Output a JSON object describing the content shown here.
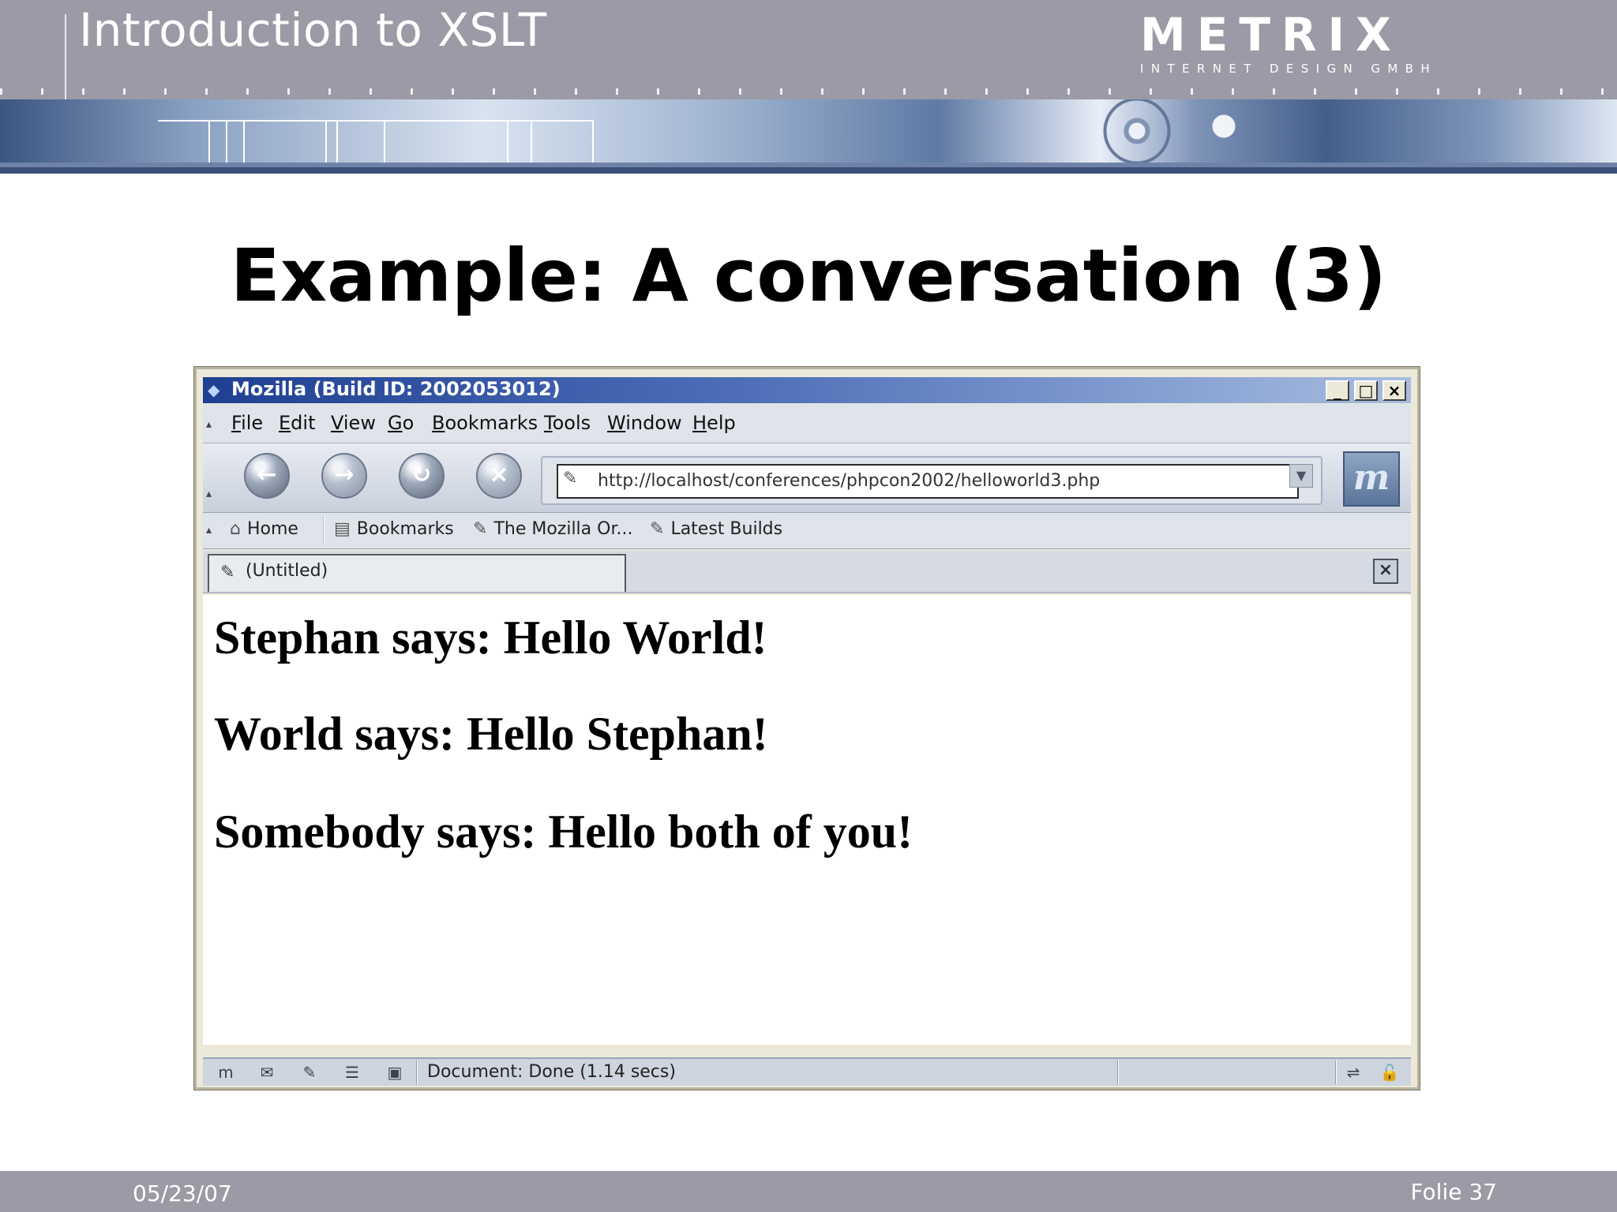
{
  "header": {
    "title": "Introduction to XSLT",
    "logo_main": "METRIX",
    "logo_sub": "INTERNET DESIGN GMBH"
  },
  "slide_title": "Example: A conversation (3)",
  "browser": {
    "title": "Mozilla (Build ID: 2002053012)",
    "window_buttons": {
      "minimize": "_",
      "maximize": "□",
      "close": "×"
    },
    "menu": {
      "file": {
        "u": "F",
        "rest": "ile"
      },
      "edit": {
        "u": "E",
        "rest": "dit"
      },
      "view": {
        "u": "V",
        "rest": "iew"
      },
      "go": {
        "u": "G",
        "rest": "o"
      },
      "bookmarks": {
        "u": "B",
        "rest": "ookmarks"
      },
      "tools": {
        "u": "T",
        "rest": "ools"
      },
      "window": {
        "u": "W",
        "rest": "indow"
      },
      "help": {
        "u": "H",
        "rest": "elp"
      }
    },
    "nav": {
      "back_icon": "←",
      "forward_icon": "→",
      "reload_icon": "↻",
      "stop_icon": "×"
    },
    "url": "http://localhost/conferences/phpcon2002/helloworld3.php",
    "throbber_text": "m",
    "bookmarks": {
      "home": "Home",
      "bookmarks": "Bookmarks",
      "mozilla_org": "The Mozilla Or...",
      "latest_builds": "Latest Builds"
    },
    "tab_label": "(Untitled)",
    "page_lines": [
      "Stephan says: Hello World!",
      "World says: Hello Stephan!",
      "Somebody says: Hello both of you!"
    ],
    "status": "Document: Done (1.14 secs)"
  },
  "footer": {
    "date": "05/23/07",
    "page": "Folie 37"
  },
  "colors": {
    "header_bg": "#9b9aa6",
    "titlebar_start": "#1f3f92",
    "titlebar_end": "#a7bde0",
    "footer_bg": "#9b9aa6"
  }
}
